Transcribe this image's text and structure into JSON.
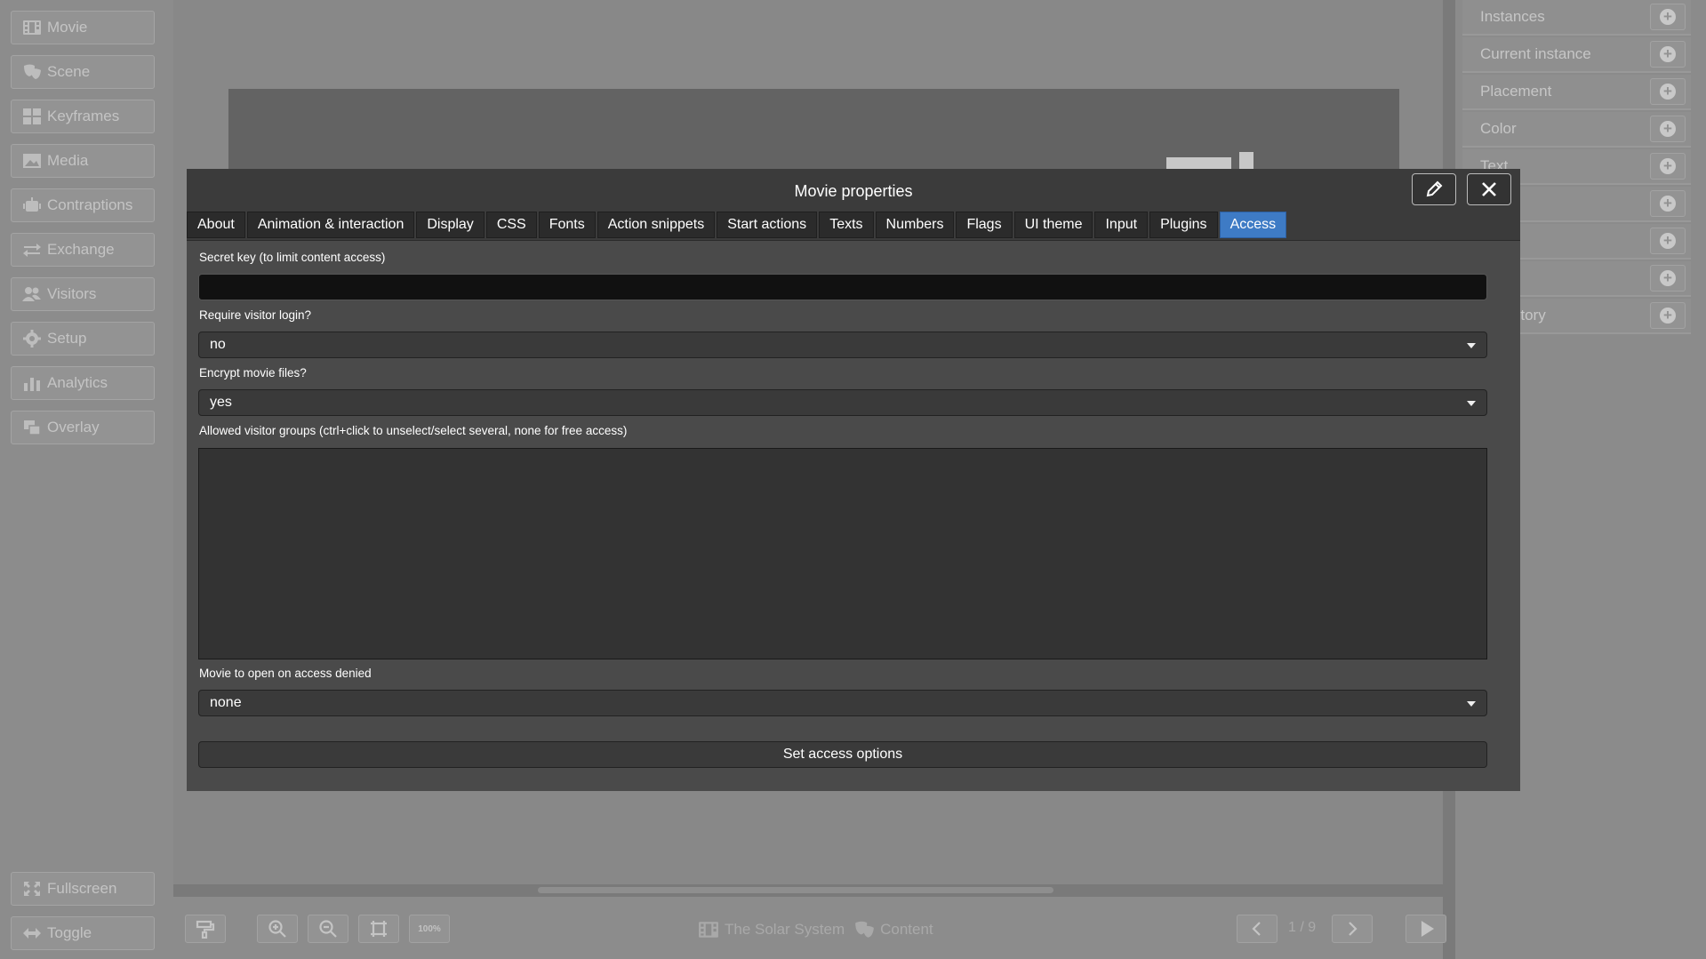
{
  "sidebar": {
    "items": [
      {
        "label": "Movie",
        "icon": "film-icon"
      },
      {
        "label": "Scene",
        "icon": "masks-icon"
      },
      {
        "label": "Keyframes",
        "icon": "grid-icon"
      },
      {
        "label": "Media",
        "icon": "image-icon"
      },
      {
        "label": "Contraptions",
        "icon": "robot-icon"
      },
      {
        "label": "Exchange",
        "icon": "exchange-icon"
      },
      {
        "label": "Visitors",
        "icon": "users-icon"
      },
      {
        "label": "Setup",
        "icon": "gear-icon"
      },
      {
        "label": "Analytics",
        "icon": "analytics-icon"
      },
      {
        "label": "Overlay",
        "icon": "overlay-icon"
      }
    ],
    "fullscreen_label": "Fullscreen",
    "toggle_label": "Toggle"
  },
  "right_panel": {
    "rows": [
      "Instances",
      "Current instance",
      "Placement",
      "Color",
      "Text",
      "",
      "",
      "",
      "ne history"
    ]
  },
  "bottom_toolbar": {
    "zoom_label": "100%",
    "movie_name": "The Solar System",
    "scene_name": "Content",
    "page_indicator": "1 / 9"
  },
  "modal": {
    "title": "Movie properties",
    "tabs": [
      "About",
      "Animation & interaction",
      "Display",
      "CSS",
      "Fonts",
      "Action snippets",
      "Start actions",
      "Texts",
      "Numbers",
      "Flags",
      "UI theme",
      "Input",
      "Plugins",
      "Access"
    ],
    "active_tab": "Access",
    "secret_key_label": "Secret key (to limit content access)",
    "secret_key_value": "",
    "require_login_label": "Require visitor login?",
    "require_login_value": "no",
    "encrypt_label": "Encrypt movie files?",
    "encrypt_value": "yes",
    "groups_label": "Allowed visitor groups (ctrl+click to unselect/select several, none for free access)",
    "denied_movie_label": "Movie to open on access denied",
    "denied_movie_value": "none",
    "submit_label": "Set access options"
  },
  "colors": {
    "active_tab": "#3e7bc5",
    "modal_bg": "#4a4a4a",
    "input_bg": "#111111"
  }
}
